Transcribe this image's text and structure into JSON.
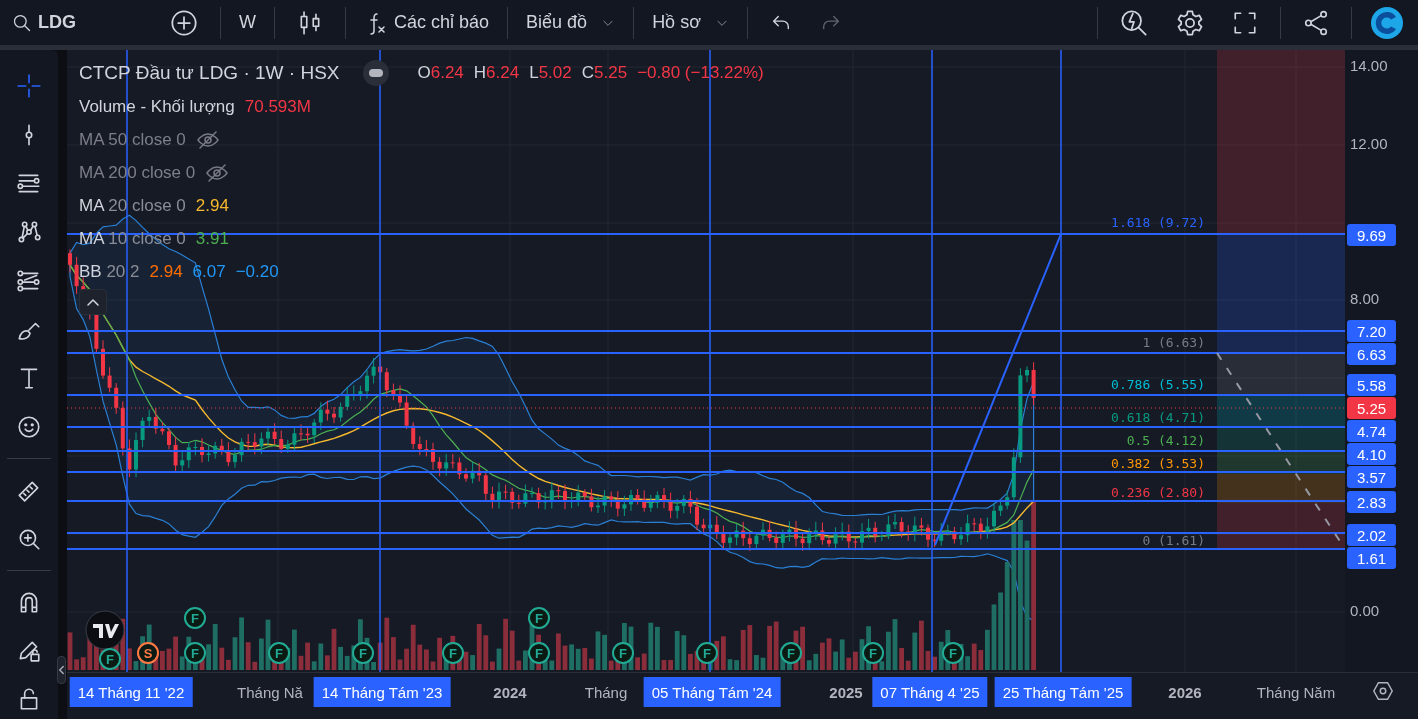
{
  "toolbar": {
    "symbol": "LDG",
    "interval": "W",
    "indicators": "Các chỉ báo",
    "menus": [
      {
        "label": "Biểu đồ"
      },
      {
        "label": "Hồ sơ"
      }
    ],
    "undo": {
      "disabled": false
    },
    "redo": {
      "disabled": true
    }
  },
  "drawing_tools": [
    {
      "selected": true
    },
    {
      "selected": false
    },
    {
      "selected": false
    },
    {
      "selected": false
    },
    {
      "selected": false
    },
    {
      "selected": false
    },
    {
      "selected": false
    },
    {
      "selected": false
    },
    {
      "selected": false
    },
    {
      "selected": false
    },
    {
      "selected": false
    },
    {
      "selected": false
    },
    {
      "selected": false
    }
  ],
  "legend": {
    "title": "CTCP Đầu tư LDG · 1W · HSX",
    "ohlc": [
      {
        "label": "O",
        "value": "6.24"
      },
      {
        "label": "H",
        "value": "6.24"
      },
      {
        "label": "L",
        "value": "5.02"
      },
      {
        "label": "C",
        "value": "5.25"
      }
    ],
    "change": "−0.80 (−13.22%)",
    "volume": {
      "label": "Volume - Khối lượng",
      "value": "70.593M"
    },
    "indicators": [
      {
        "name": "MA",
        "params": "50 close 0",
        "visible": false
      },
      {
        "name": "MA",
        "params": "200 close 0",
        "visible": false
      },
      {
        "name": "MA",
        "params": "20 close 0",
        "visible": true,
        "values": [
          {
            "text": "2.94",
            "color": "#f5b82e"
          }
        ]
      },
      {
        "name": "MA",
        "params": "10 close 0",
        "visible": true,
        "values": [
          {
            "text": "3.91",
            "color": "#4caf50"
          }
        ]
      },
      {
        "name": "BB",
        "params": "20 2",
        "visible": true,
        "values": [
          {
            "text": "2.94",
            "color": "#ff6d00"
          },
          {
            "text": "6.07",
            "color": "#2196f3"
          },
          {
            "text": "−0.20",
            "color": "#2196f3"
          }
        ]
      }
    ]
  },
  "fib_levels": [
    {
      "text": "1.618 (9.72)",
      "color": "#2962ff"
    },
    {
      "text": "1 (6.63)",
      "color": "#787b86"
    },
    {
      "text": "0.786 (5.55)",
      "color": "#00bcd4"
    },
    {
      "text": "0.618 (4.71)",
      "color": "#089981"
    },
    {
      "text": "0.5 (4.12)",
      "color": "#4caf50"
    },
    {
      "text": "0.382 (3.53)",
      "color": "#ff9800"
    },
    {
      "text": "0.236 (2.80)",
      "color": "#f23645"
    },
    {
      "text": "0 (1.61)",
      "color": "#787b86"
    }
  ],
  "price_axis": {
    "ticks": [
      "14.00",
      "12.00",
      "8.00",
      "0.00"
    ],
    "tags": [
      {
        "text": "9.69",
        "color": "#2962ff"
      },
      {
        "text": "7.20",
        "color": "#2962ff"
      },
      {
        "text": "6.63",
        "color": "#2962ff"
      },
      {
        "text": "5.58",
        "color": "#2962ff"
      },
      {
        "text": "5.25",
        "color": "#f23645"
      },
      {
        "text": "4.74",
        "color": "#2962ff"
      },
      {
        "text": "4.10",
        "color": "#2962ff"
      },
      {
        "text": "3.57",
        "color": "#2962ff"
      },
      {
        "text": "2.83",
        "color": "#2962ff"
      },
      {
        "text": "2.02",
        "color": "#2962ff"
      },
      {
        "text": "1.61",
        "color": "#2962ff"
      }
    ]
  },
  "events": [
    {
      "label": "F",
      "color": "#22ab94"
    },
    {
      "label": "F",
      "color": "#22ab94"
    },
    {
      "label": "F",
      "color": "#22ab94"
    },
    {
      "label": "S",
      "color": "#ff7a45"
    },
    {
      "label": "F",
      "color": "#22ab94"
    },
    {
      "label": "F",
      "color": "#22ab94"
    },
    {
      "label": "F",
      "color": "#22ab94"
    },
    {
      "label": "F",
      "color": "#22ab94"
    },
    {
      "label": "F",
      "color": "#22ab94"
    },
    {
      "label": "F",
      "color": "#22ab94"
    },
    {
      "label": "F",
      "color": "#22ab94"
    },
    {
      "label": "F",
      "color": "#22ab94"
    },
    {
      "label": "F",
      "color": "#22ab94"
    },
    {
      "label": "F",
      "color": "#22ab94"
    }
  ],
  "time_axis": [
    {
      "text": "14 Tháng 11 '22",
      "kind": "marker"
    },
    {
      "text": "Tháng Nă",
      "kind": "month"
    },
    {
      "text": "14 Tháng Tám '23",
      "kind": "marker"
    },
    {
      "text": "2024",
      "kind": "year"
    },
    {
      "text": "Tháng",
      "kind": "month"
    },
    {
      "text": "05 Tháng Tám '24",
      "kind": "marker"
    },
    {
      "text": "2025",
      "kind": "year"
    },
    {
      "text": "07 Tháng 4 '25",
      "kind": "marker"
    },
    {
      "text": "25 Tháng Tám '25",
      "kind": "marker"
    },
    {
      "text": "2026",
      "kind": "year"
    },
    {
      "text": "Tháng Năm",
      "kind": "month"
    }
  ]
}
